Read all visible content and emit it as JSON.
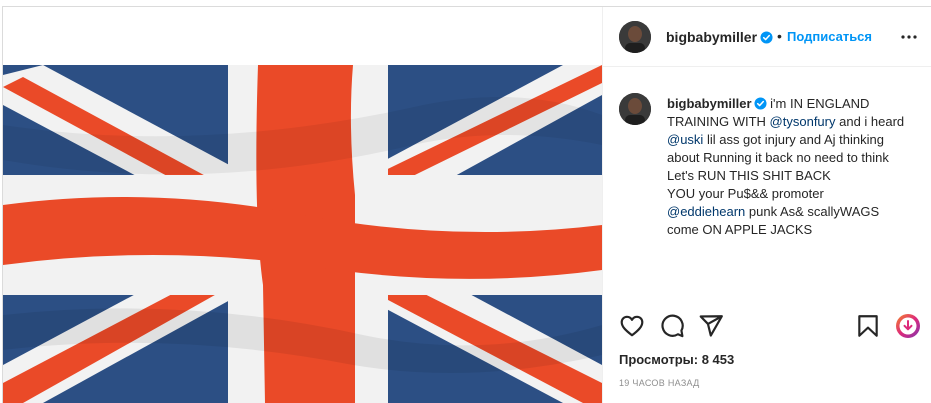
{
  "header": {
    "username": "bigbabymiller",
    "verified_icon": "verified-badge-icon",
    "separator": "•",
    "follow_label": "Подписаться",
    "more_icon": "more-options-icon"
  },
  "caption": {
    "username": "bigbabymiller",
    "line1_pre": "i'm IN ENGLAND TRAINING WITH ",
    "mention1": "@tysonfury",
    "line1_post": " and i heard ",
    "mention2": "@uski",
    "line2": " lil ass got injury and Aj thinking about Running it back no need to think\nLet's RUN THIS SHIT BACK\nYOU your Pu$&& promoter\n",
    "mention3": "@eddiehearn",
    "line3": " punk As& scallyWAGS\ncome ON APPLE JACKS"
  },
  "actions": {
    "like_icon": "heart-icon",
    "comment_icon": "comment-icon",
    "share_icon": "share-icon",
    "save_icon": "bookmark-icon",
    "download_icon": "download-icon"
  },
  "stats": {
    "views": "Просмотры: 8 453",
    "time": "19 ЧАСОВ НАЗАД"
  },
  "colors": {
    "link": "#0095f6",
    "mention": "#00376b",
    "flag_blue": "#2c4f84",
    "flag_red": "#ea4a28",
    "flag_white": "#f2f2f2"
  }
}
